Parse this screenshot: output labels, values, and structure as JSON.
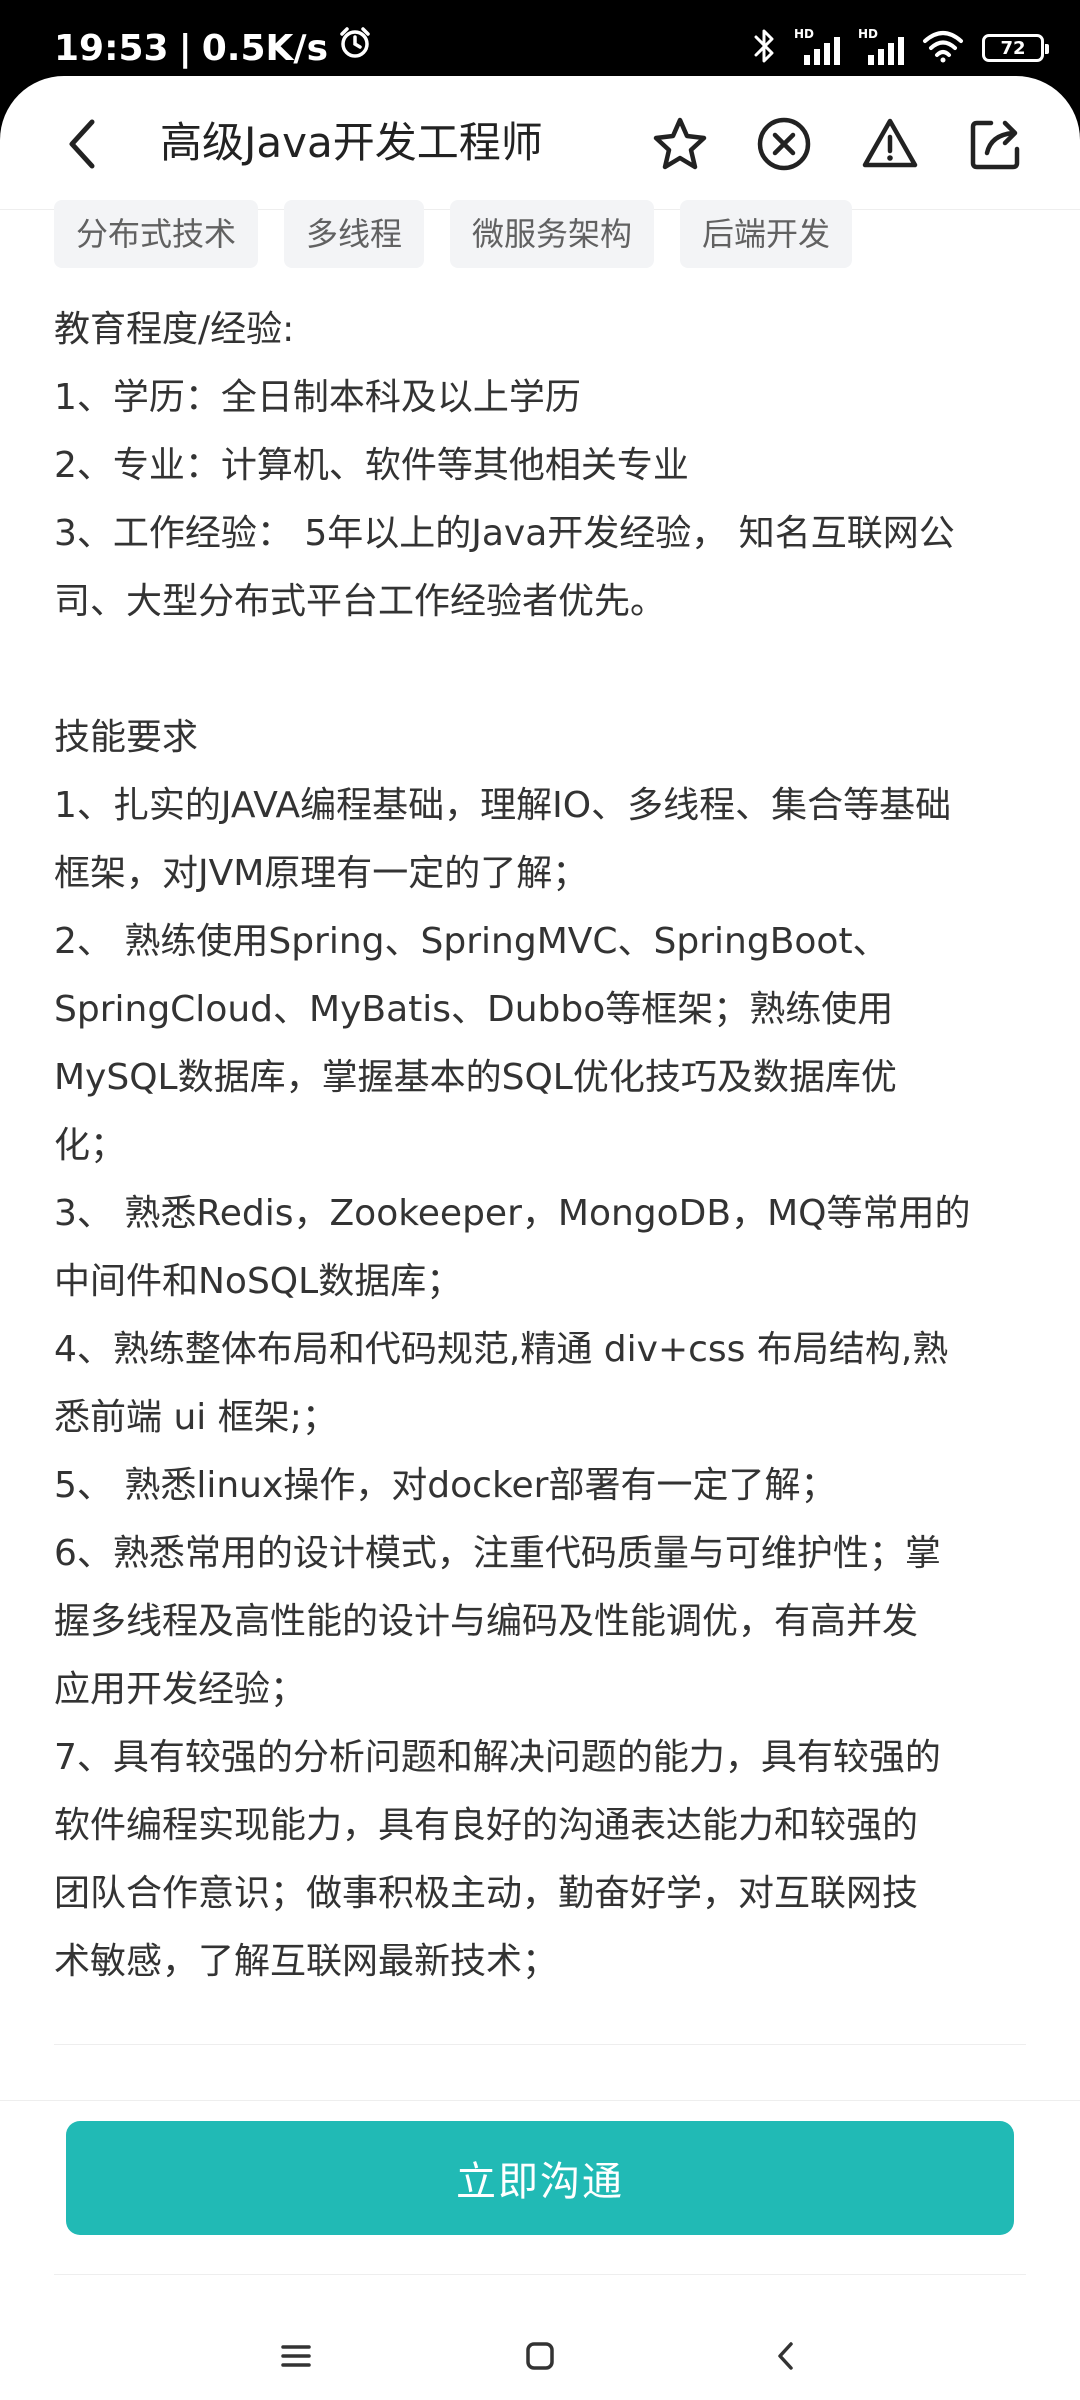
{
  "status_bar": {
    "time": "19:53",
    "separator": "|",
    "speed": "0.5K/s",
    "hd1": "HD",
    "hd2": "HD",
    "battery": "72"
  },
  "header": {
    "title": "高级Java开发工程师",
    "icons": [
      "back-icon",
      "star-icon",
      "close-circle-icon",
      "warning-icon",
      "share-icon"
    ]
  },
  "tags": [
    "分布式技术",
    "多线程",
    "微服务架构",
    "后端开发"
  ],
  "description": {
    "lines": [
      "教育程度/经验:",
      "1、学历：全日制本科及以上学历",
      "2、专业：计算机、软件等其他相关专业",
      "3、工作经验： 5年以上的Java开发经验， 知名互联网公",
      "司、大型分布式平台工作经验者优先。",
      "",
      "技能要求",
      "1、扎实的JAVA编程基础，理解IO、多线程、集合等基础",
      "框架，对JVM原理有一定的了解；",
      "2、 熟练使用Spring、SpringMVC、SpringBoot、",
      "SpringCloud、MyBatis、Dubbo等框架；熟练使用",
      "MySQL数据库，掌握基本的SQL优化技巧及数据库优",
      "化；",
      "3、 熟悉Redis，Zookeeper，MongoDB，MQ等常用的",
      "中间件和NoSQL数据库；",
      "4、熟练整体布局和代码规范,精通 div+css 布局结构,熟",
      "悉前端 ui 框架;；",
      "5、 熟悉linux操作，对docker部署有一定了解；",
      "6、熟悉常用的设计模式，注重代码质量与可维护性；掌",
      "握多线程及高性能的设计与编码及性能调优，有高并发",
      "应用开发经验；",
      "7、具有较强的分析问题和解决问题的能力，具有较强的",
      "软件编程实现能力，具有良好的沟通表达能力和较强的",
      "团队合作意识；做事积极主动，勤奋好学，对互联网技",
      "术敏感，了解互联网最新技术；"
    ]
  },
  "footer": {
    "chat_button": "立即沟通"
  },
  "nav": {
    "icons": [
      "menu-icon",
      "home-icon",
      "back-nav-icon"
    ]
  },
  "colors": {
    "accent": "#21bab5",
    "tag_bg": "#f3f4f6",
    "text": "#333333"
  }
}
